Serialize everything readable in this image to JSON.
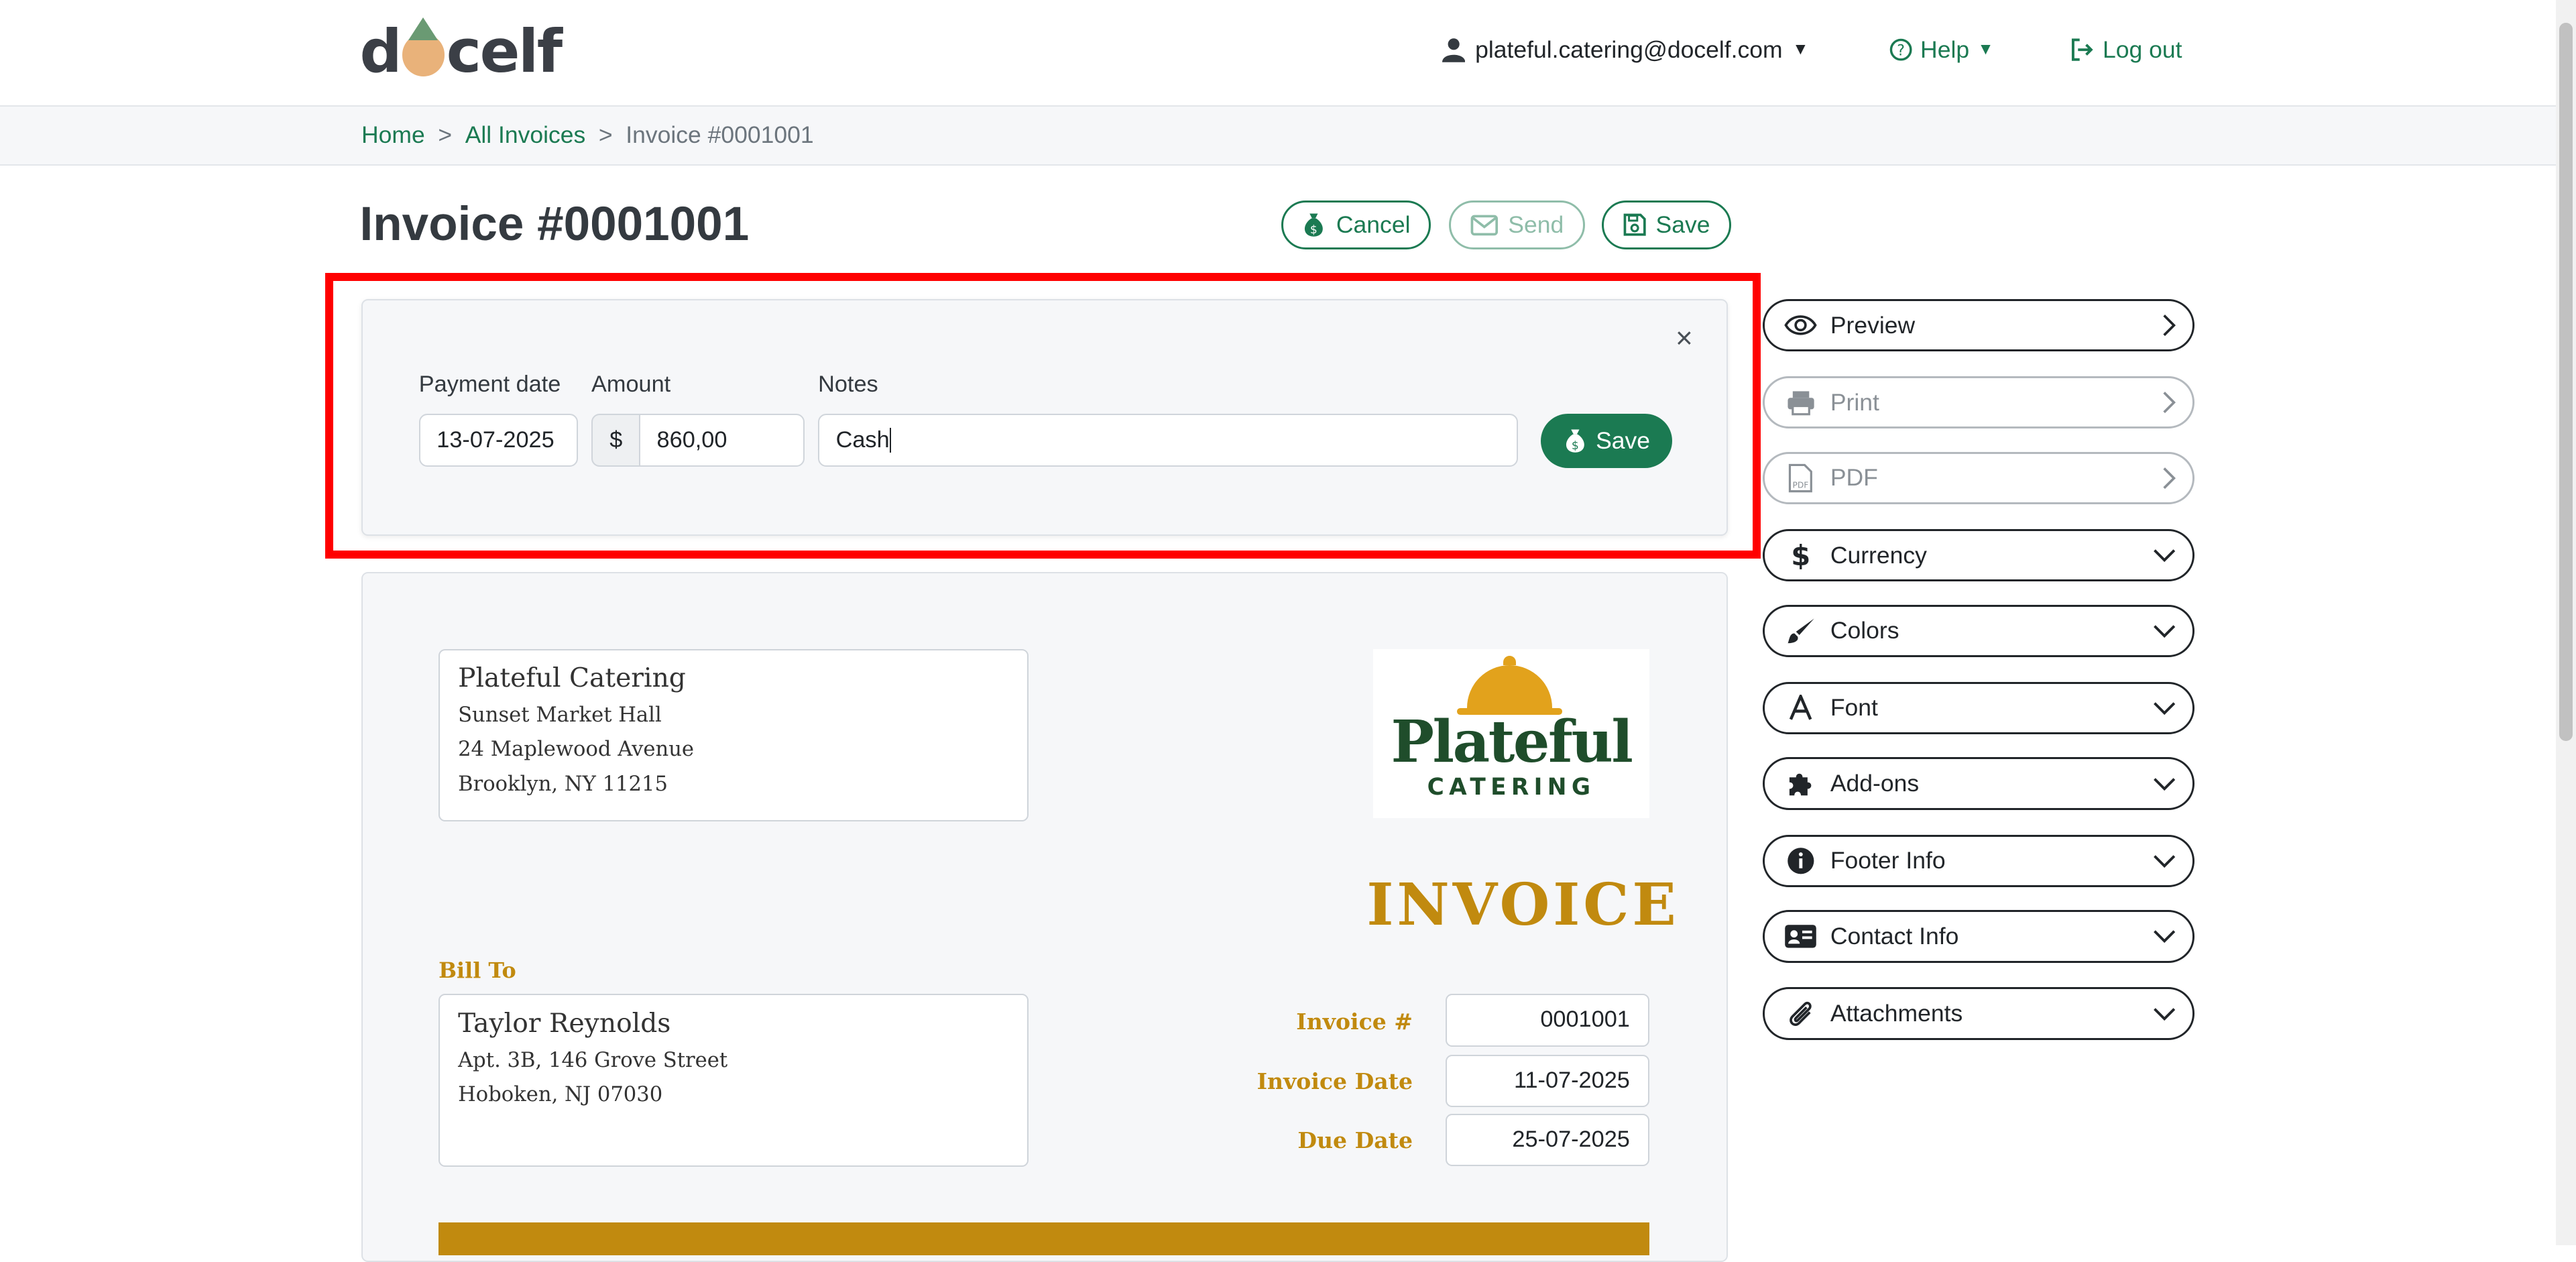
{
  "header": {
    "logo_text": "docelf",
    "user_email": "plateful.catering@docelf.com",
    "help_label": "Help",
    "logout_label": "Log out"
  },
  "breadcrumb": {
    "home": "Home",
    "sep": ">",
    "all_invoices": "All Invoices",
    "current": "Invoice #0001001"
  },
  "page": {
    "title": "Invoice #0001001",
    "cancel_label": "Cancel",
    "send_label": "Send",
    "save_label": "Save"
  },
  "payment": {
    "date_label": "Payment date",
    "amount_label": "Amount",
    "notes_label": "Notes",
    "date_value": "13-07-2025",
    "currency_symbol": "$",
    "amount_value": "860,00",
    "notes_value": "Cash",
    "close": "×",
    "save_label": "Save"
  },
  "invoice": {
    "from": {
      "name": "Plateful Catering",
      "line1": "Sunset Market Hall",
      "line2": "24 Maplewood Avenue",
      "line3": "Brooklyn, NY 11215"
    },
    "logo_word1": "Plateful",
    "logo_word2": "CATERING",
    "heading": "INVOICE",
    "bill_to_label": "Bill To",
    "to": {
      "name": "Taylor Reynolds",
      "line1": "Apt. 3B, 146 Grove Street",
      "line2": "Hoboken, NJ 07030"
    },
    "meta": {
      "number_label": "Invoice #",
      "number_value": "0001001",
      "date_label": "Invoice Date",
      "date_value": "11-07-2025",
      "due_label": "Due Date",
      "due_value": "25-07-2025"
    }
  },
  "sidebar": {
    "items": [
      {
        "label": "Preview",
        "icon": "eye-icon"
      },
      {
        "label": "Print",
        "icon": "printer-icon"
      },
      {
        "label": "PDF",
        "icon": "pdf-file-icon"
      },
      {
        "label": "Currency",
        "icon": "dollar-icon"
      },
      {
        "label": "Colors",
        "icon": "paintbrush-icon"
      },
      {
        "label": "Font",
        "icon": "font-icon"
      },
      {
        "label": "Add-ons",
        "icon": "puzzle-icon"
      },
      {
        "label": "Footer Info",
        "icon": "info-icon"
      },
      {
        "label": "Contact Info",
        "icon": "id-card-icon"
      },
      {
        "label": "Attachments",
        "icon": "paperclip-icon"
      }
    ]
  },
  "colors": {
    "brand_green": "#1b7a52",
    "invoice_gold": "#c18a0f",
    "highlight_red": "#ff0000"
  }
}
